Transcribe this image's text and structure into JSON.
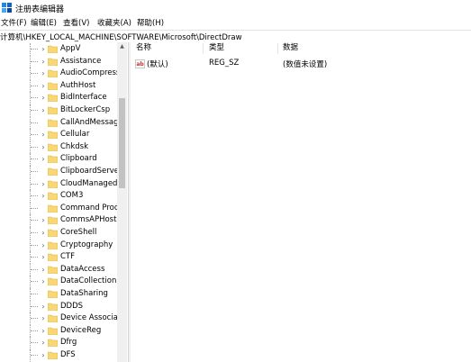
{
  "window": {
    "title": "注册表编辑器",
    "icon": "registry-editor-icon"
  },
  "menu": {
    "items": [
      "文件(F)",
      "编辑(E)",
      "查看(V)",
      "收藏夹(A)",
      "帮助(H)"
    ]
  },
  "address": {
    "path": "计算机\\HKEY_LOCAL_MACHINE\\SOFTWARE\\Microsoft\\DirectDraw"
  },
  "tree": {
    "items": [
      {
        "label": "AppV",
        "expandable": true
      },
      {
        "label": "Assistance",
        "expandable": true
      },
      {
        "label": "AudioCompress",
        "expandable": true
      },
      {
        "label": "AuthHost",
        "expandable": true
      },
      {
        "label": "BidInterface",
        "expandable": true
      },
      {
        "label": "BitLockerCsp",
        "expandable": true
      },
      {
        "label": "CallAndMessag",
        "expandable": false
      },
      {
        "label": "Cellular",
        "expandable": true
      },
      {
        "label": "Chkdsk",
        "expandable": true
      },
      {
        "label": "Clipboard",
        "expandable": true
      },
      {
        "label": "ClipboardServe",
        "expandable": false
      },
      {
        "label": "CloudManaged",
        "expandable": true
      },
      {
        "label": "COM3",
        "expandable": true
      },
      {
        "label": "Command Proc",
        "expandable": false
      },
      {
        "label": "CommsAPHost",
        "expandable": true
      },
      {
        "label": "CoreShell",
        "expandable": true
      },
      {
        "label": "Cryptography",
        "expandable": true
      },
      {
        "label": "CTF",
        "expandable": true
      },
      {
        "label": "DataAccess",
        "expandable": true
      },
      {
        "label": "DataCollection",
        "expandable": true
      },
      {
        "label": "DataSharing",
        "expandable": false
      },
      {
        "label": "DDDS",
        "expandable": true
      },
      {
        "label": "Device Associat",
        "expandable": true
      },
      {
        "label": "DeviceReg",
        "expandable": true
      },
      {
        "label": "Dfrg",
        "expandable": true
      },
      {
        "label": "DFS",
        "expandable": true
      }
    ]
  },
  "list": {
    "columns": [
      "名称",
      "类型",
      "数据"
    ],
    "rows": [
      {
        "name": "(默认)",
        "type": "REG_SZ",
        "data": "(数值未设置)",
        "icon": "string-value-icon"
      }
    ]
  },
  "colors": {
    "folder": "#f8d775",
    "folder_edge": "#d9b545",
    "selection": "#cce8ff"
  }
}
